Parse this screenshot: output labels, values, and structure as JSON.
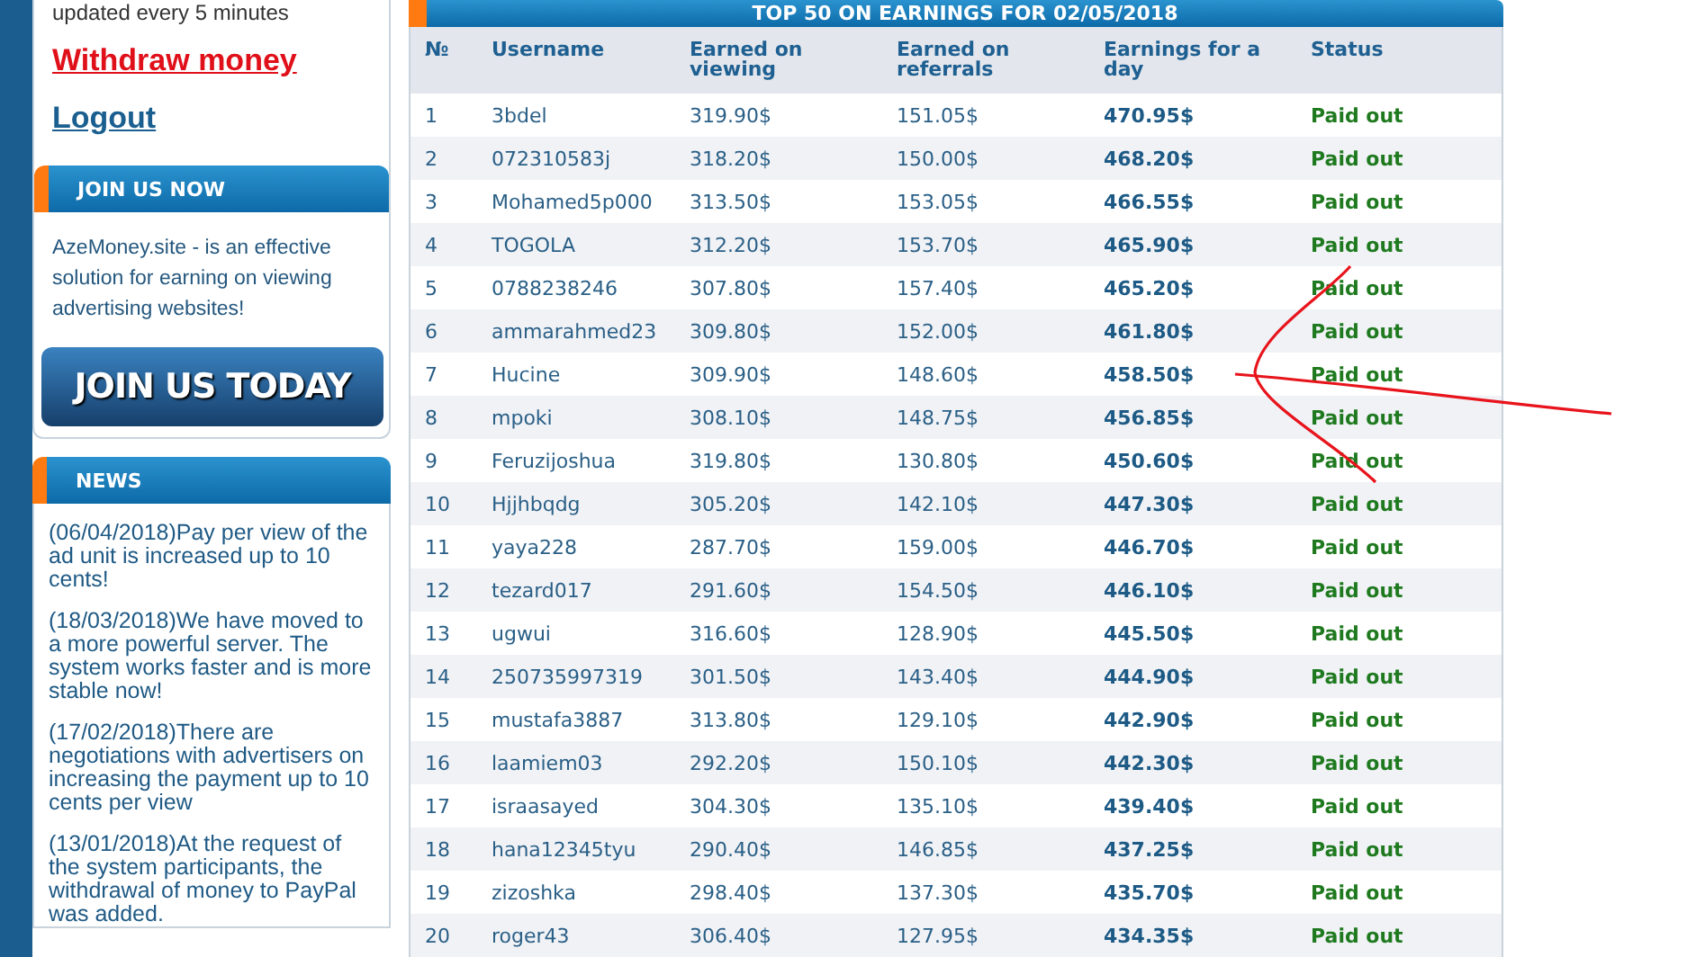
{
  "sidebar": {
    "update_note": "updated every 5 minutes",
    "links": [
      {
        "label": "Withdraw money",
        "kind": "alert"
      },
      {
        "label": "Logout",
        "kind": "normal"
      }
    ],
    "join_panel": {
      "title": "JOIN US NOW",
      "text": "AzeMoney.site - is an effective solution for earning on viewing advertising websites!",
      "button": "JOIN US TODAY"
    },
    "news_panel": {
      "title": "NEWS",
      "items": [
        "(06/04/2018)Pay per view of the ad unit is increased up to 10 cents!",
        "(18/03/2018)We have moved to a more powerful server. The system works faster and is more stable now!",
        "(17/02/2018)There are negotiations with advertisers on increasing the payment up to 10 cents per view",
        "(13/01/2018)At the request of the system participants, the withdrawal of money to PayPal was added."
      ]
    }
  },
  "table": {
    "title": "TOP 50 ON EARNINGS FOR 02/05/2018",
    "columns": [
      "№",
      "Username",
      "Earned on viewing",
      "Earned on referrals",
      "Earnings for a day",
      "Status"
    ],
    "rows": [
      [
        "1",
        "3bdel",
        "319.90$",
        "151.05$",
        "470.95$",
        "Paid out"
      ],
      [
        "2",
        "072310583j",
        "318.20$",
        "150.00$",
        "468.20$",
        "Paid out"
      ],
      [
        "3",
        "Mohamed5p000",
        "313.50$",
        "153.05$",
        "466.55$",
        "Paid out"
      ],
      [
        "4",
        "TOGOLA",
        "312.20$",
        "153.70$",
        "465.90$",
        "Paid out"
      ],
      [
        "5",
        "0788238246",
        "307.80$",
        "157.40$",
        "465.20$",
        "Paid out"
      ],
      [
        "6",
        "ammarahmed23",
        "309.80$",
        "152.00$",
        "461.80$",
        "Paid out"
      ],
      [
        "7",
        "Hucine",
        "309.90$",
        "148.60$",
        "458.50$",
        "Paid out"
      ],
      [
        "8",
        "mpoki",
        "308.10$",
        "148.75$",
        "456.85$",
        "Paid out"
      ],
      [
        "9",
        "Feruzijoshua",
        "319.80$",
        "130.80$",
        "450.60$",
        "Paid out"
      ],
      [
        "10",
        "Hjjhbqdg",
        "305.20$",
        "142.10$",
        "447.30$",
        "Paid out"
      ],
      [
        "11",
        "yaya228",
        "287.70$",
        "159.00$",
        "446.70$",
        "Paid out"
      ],
      [
        "12",
        "tezard017",
        "291.60$",
        "154.50$",
        "446.10$",
        "Paid out"
      ],
      [
        "13",
        "ugwui",
        "316.60$",
        "128.90$",
        "445.50$",
        "Paid out"
      ],
      [
        "14",
        "250735997319",
        "301.50$",
        "143.40$",
        "444.90$",
        "Paid out"
      ],
      [
        "15",
        "mustafa3887",
        "313.80$",
        "129.10$",
        "442.90$",
        "Paid out"
      ],
      [
        "16",
        "laamiem03",
        "292.20$",
        "150.10$",
        "442.30$",
        "Paid out"
      ],
      [
        "17",
        "israasayed",
        "304.30$",
        "135.10$",
        "439.40$",
        "Paid out"
      ],
      [
        "18",
        "hana12345tyu",
        "290.40$",
        "146.85$",
        "437.25$",
        "Paid out"
      ],
      [
        "19",
        "zizoshka",
        "298.40$",
        "137.30$",
        "435.70$",
        "Paid out"
      ],
      [
        "20",
        "roger43",
        "306.40$",
        "127.95$",
        "434.35$",
        "Paid out"
      ]
    ]
  }
}
